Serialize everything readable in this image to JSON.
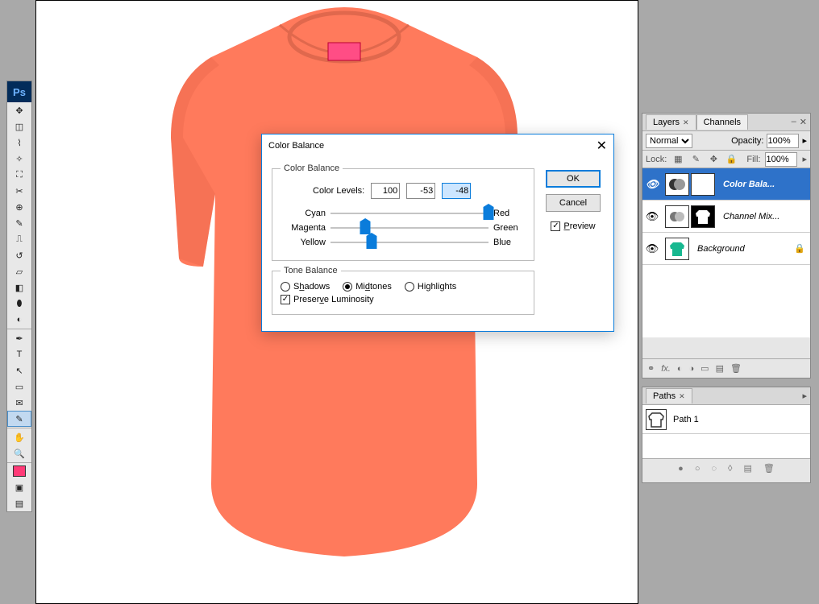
{
  "tshirt_color": "#ff7a5c",
  "dialog": {
    "title": "Color Balance",
    "group_color": "Color Balance",
    "levels_label": "Color Levels:",
    "levels": [
      "100",
      "-53",
      "-48"
    ],
    "sliders": [
      {
        "left": "Cyan",
        "right": "Red",
        "pos": 100
      },
      {
        "left": "Magenta",
        "right": "Green",
        "pos": 22
      },
      {
        "left": "Yellow",
        "right": "Blue",
        "pos": 26
      }
    ],
    "group_tone": "Tone Balance",
    "tone_shadows": "Shadows",
    "tone_midtones": "Midtones",
    "tone_highlights": "Highlights",
    "preserve": "Preserve Luminosity",
    "ok": "OK",
    "cancel": "Cancel",
    "preview": "Preview"
  },
  "layers_panel": {
    "tab_layers": "Layers",
    "tab_channels": "Channels",
    "blend_mode": "Normal",
    "opacity_label": "Opacity:",
    "opacity": "100%",
    "lock_label": "Lock:",
    "fill_label": "Fill:",
    "fill": "100%",
    "layers": [
      {
        "name": "Color Bala...",
        "selected": true
      },
      {
        "name": "Channel Mix...",
        "selected": false
      },
      {
        "name": "Background",
        "selected": false,
        "locked": true
      }
    ]
  },
  "paths_panel": {
    "tab": "Paths",
    "items": [
      {
        "name": "Path 1"
      }
    ]
  }
}
